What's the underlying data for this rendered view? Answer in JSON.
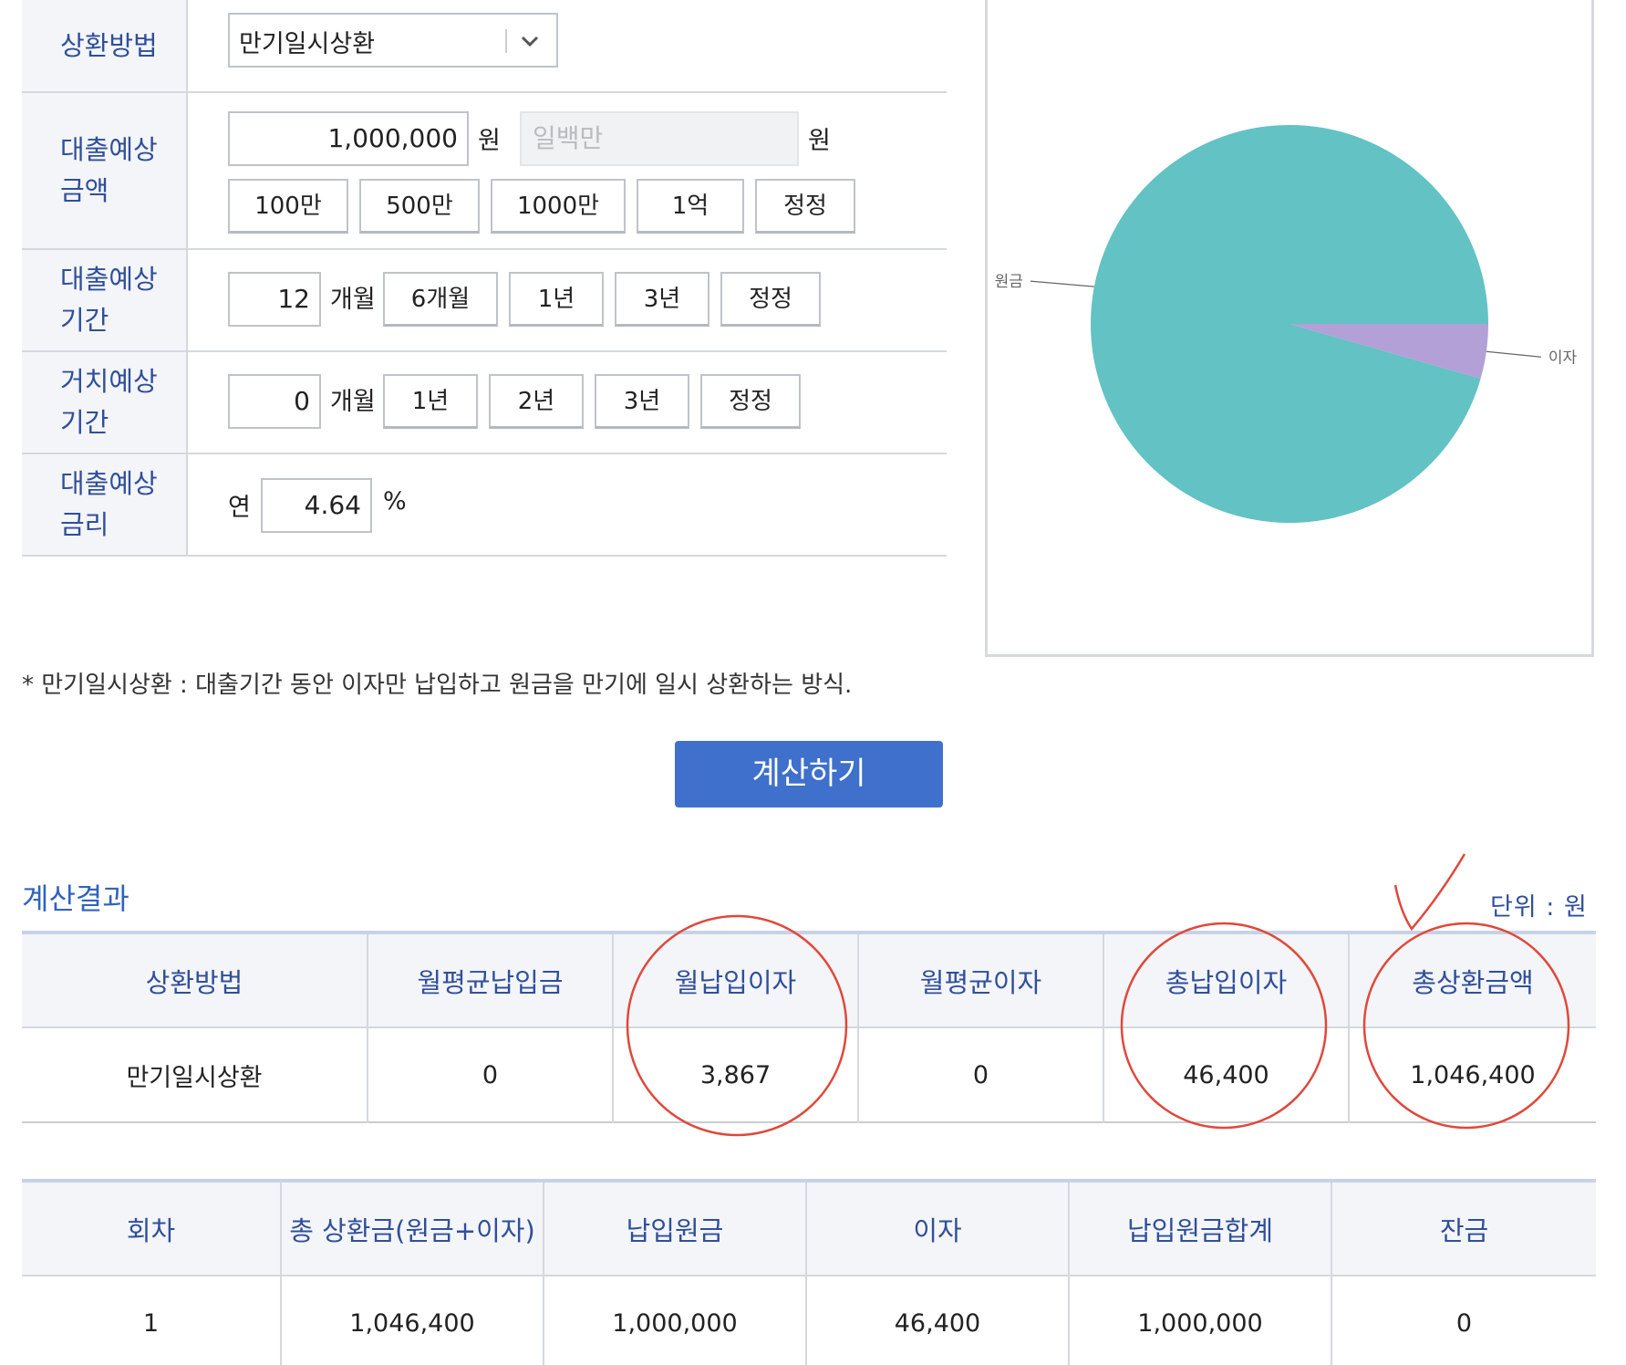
{
  "form": {
    "method_label": "상환방법",
    "method_value": "만기일시상환",
    "amount_label_1": "대출예상",
    "amount_label_2": "금액",
    "amount_value": "1,000,000",
    "amount_unit": "원",
    "amount_korean_placeholder": "일백만",
    "amount_korean_unit": "원",
    "amount_buttons": [
      "100만",
      "500만",
      "1000만",
      "1억",
      "정정"
    ],
    "period_label_1": "대출예상",
    "period_label_2": "기간",
    "period_value": "12",
    "period_unit": "개월",
    "period_buttons": [
      "6개월",
      "1년",
      "3년",
      "정정"
    ],
    "grace_label_1": "거치예상",
    "grace_label_2": "기간",
    "grace_value": "0",
    "grace_unit": "개월",
    "grace_buttons": [
      "1년",
      "2년",
      "3년",
      "정정"
    ],
    "rate_label_1": "대출예상",
    "rate_label_2": "금리",
    "rate_prefix": "연",
    "rate_value": "4.64",
    "rate_unit": "%"
  },
  "chart_data": {
    "type": "pie",
    "categories": [
      "원금",
      "이자"
    ],
    "values": [
      1000000,
      46400
    ],
    "colors": [
      "#62c2c4",
      "#b3a0d6"
    ]
  },
  "note": "* 만기일시상환 : 대출기간 동안 이자만 납입하고 원금을 만기에 일시 상환하는 방식.",
  "calc_button": "계산하기",
  "result": {
    "title": "계산결과",
    "unit_note": "단위 : 원",
    "summary_headers": [
      "상환방법",
      "월평균납입금",
      "월납입이자",
      "월평균이자",
      "총납입이자",
      "총상환금액"
    ],
    "summary_values": [
      "만기일시상환",
      "0",
      "3,867",
      "0",
      "46,400",
      "1,046,400"
    ],
    "schedule_headers": [
      "회차",
      "총 상환금(원금+이자)",
      "납입원금",
      "이자",
      "납입원금합계",
      "잔금"
    ],
    "schedule_rows": [
      [
        "1",
        "1,046,400",
        "1,000,000",
        "46,400",
        "1,000,000",
        "0"
      ]
    ]
  },
  "annotation_color": "#e0483b"
}
